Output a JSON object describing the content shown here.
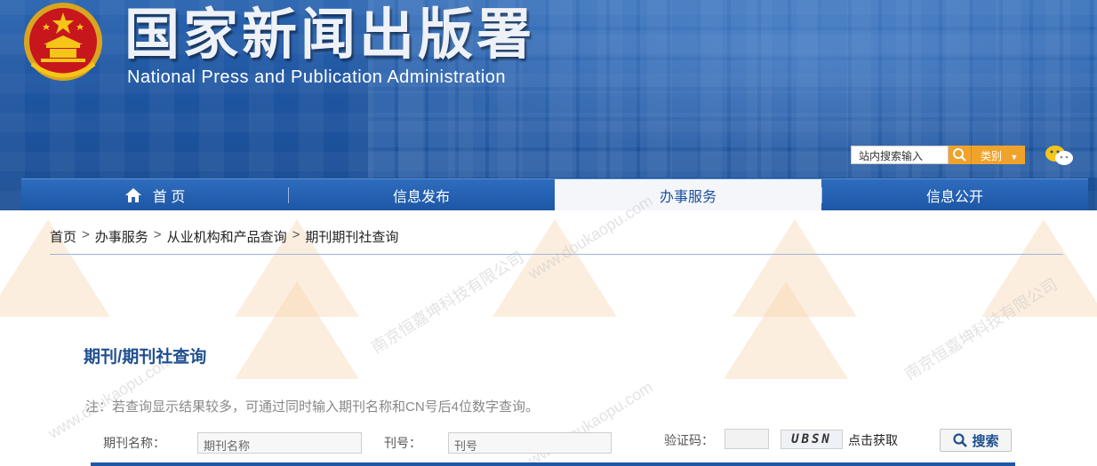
{
  "header": {
    "title": "国家新闻出版署",
    "subtitle": "National  Press and Publication Administration",
    "search_placeholder": "站内搜索输入",
    "category_label": "类别",
    "emblem_icon": "national-emblem-icon",
    "wechat_icon": "wechat-icon"
  },
  "nav": {
    "items": [
      {
        "label": "首 页",
        "icon": "home-icon"
      },
      {
        "label": "信息发布"
      },
      {
        "label": "办事服务",
        "active": true
      },
      {
        "label": "信息公开"
      }
    ]
  },
  "breadcrumb": {
    "items": [
      "首页",
      "办事服务",
      "从业机构和产品查询",
      "期刊期刊社查询"
    ],
    "separator": ">"
  },
  "main": {
    "title": "期刊/期刊社查询",
    "note": "注：若查询显示结果较多，可通过同时输入期刊名称和CN号后4位数字查询。"
  },
  "form": {
    "name_label": "期刊名称：",
    "name_placeholder": "期刊名称",
    "issue_label": "刊号：",
    "issue_placeholder": "刊号",
    "captcha_label": "验证码：",
    "captcha_value": "",
    "captcha_text": "UBSN",
    "captcha_refresh": "点击获取",
    "search_button": "搜索"
  },
  "watermarks": {
    "company": "南京恒嘉坤科技有限公司",
    "site": "www.doukaopu.com"
  },
  "colors": {
    "brand_blue": "#1d57a6",
    "accent_orange": "#f0a32a",
    "title_blue": "#1f4f8f"
  }
}
